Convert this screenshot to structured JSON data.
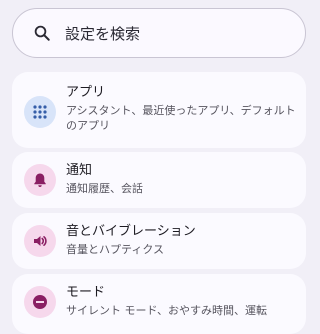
{
  "search": {
    "placeholder": "設定を検索"
  },
  "items": [
    {
      "icon": "apps-grid-icon",
      "title": "アプリ",
      "subtitle": "アシスタント、最近使ったアプリ、デフォルトのアプリ",
      "icon_color": "#355ea8",
      "icon_bg": "#d8e4f9"
    },
    {
      "icon": "bell-icon",
      "title": "通知",
      "subtitle": "通知履歴、会話",
      "icon_color": "#8a1f63",
      "icon_bg": "#f6d8ec"
    },
    {
      "icon": "speaker-icon",
      "title": "音とバイブレーション",
      "subtitle": "音量とハプティクス",
      "icon_color": "#8a1f63",
      "icon_bg": "#f6d8ec"
    },
    {
      "icon": "minus-circle-icon",
      "title": "モード",
      "subtitle": "サイレント モード、おやすみ時間、運転",
      "icon_color": "#8a1f63",
      "icon_bg": "#f6d8ec"
    }
  ]
}
